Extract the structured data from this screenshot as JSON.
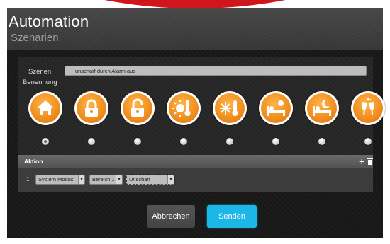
{
  "header": {
    "title": "Automation",
    "subtitle": "Szenarien"
  },
  "form": {
    "scene_label": "Szenen",
    "naming_label": "Benennung :",
    "scene_name_value": "unscharf durch Alarm aus"
  },
  "scene_icons": [
    {
      "name": "home-icon",
      "selected": true
    },
    {
      "name": "lock-closed-icon",
      "selected": false
    },
    {
      "name": "lock-open-icon",
      "selected": false
    },
    {
      "name": "sun-thermometer-icon",
      "selected": false
    },
    {
      "name": "snow-thermometer-icon",
      "selected": false
    },
    {
      "name": "bed-sun-icon",
      "selected": false
    },
    {
      "name": "bed-moon-icon",
      "selected": false
    },
    {
      "name": "champagne-glasses-icon",
      "selected": false
    }
  ],
  "action": {
    "title": "Aktion",
    "rows": [
      {
        "index": "1",
        "mode": "System Modus",
        "area": "Bereich 1",
        "state": "Unscharf"
      }
    ]
  },
  "buttons": {
    "cancel": "Abbrechen",
    "send": "Senden"
  },
  "colors": {
    "accent_orange": "#f08d1e",
    "send_blue": "#1ab7e7",
    "background_dark": "#181818",
    "brand_red": "#d0161c"
  }
}
